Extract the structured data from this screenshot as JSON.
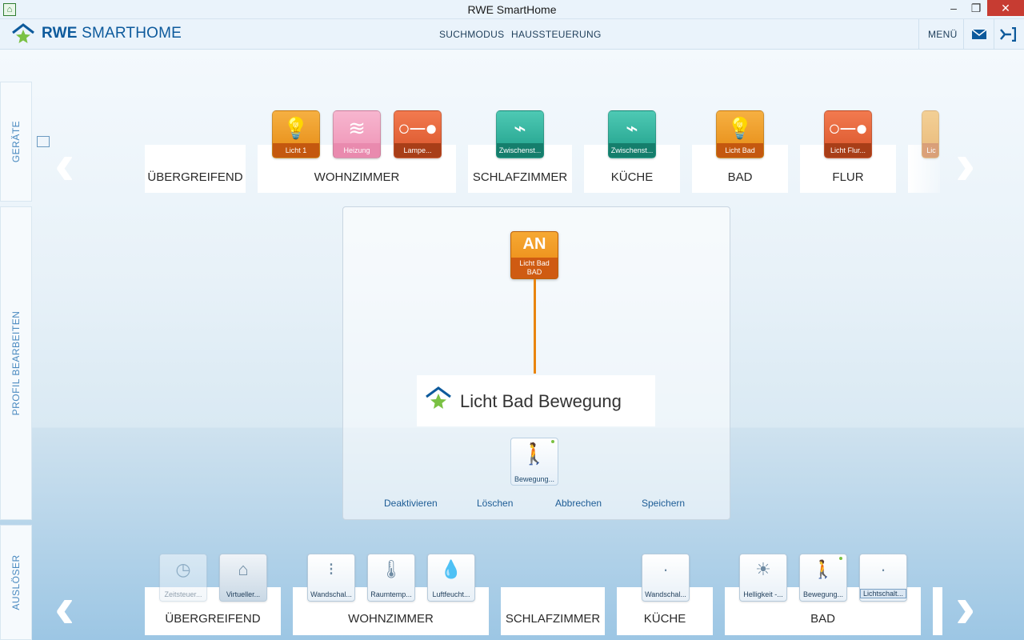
{
  "window": {
    "title": "RWE SmartHome",
    "minimize": "–",
    "restore": "❐",
    "close": "✕"
  },
  "header": {
    "logo_bold": "RWE",
    "logo_rest": " SMARTHOME",
    "nav": {
      "search": "SUCHMODUS",
      "house": "HAUSSTEUERUNG"
    },
    "menu": "MENÜ"
  },
  "sidetabs": {
    "devices": "GERÄTE",
    "profile": "PROFIL BEARBEITEN",
    "triggers": "AUSLÖSER"
  },
  "devices": {
    "rooms": [
      "ÜBERGREIFEND",
      "WOHNZIMMER",
      "SCHLAFZIMMER",
      "KÜCHE",
      "BAD",
      "FLUR"
    ],
    "items": [
      {
        "label": "Licht 1",
        "icon": "lightbulb-icon"
      },
      {
        "label": "Heizung",
        "icon": "heating-icon"
      },
      {
        "label": "Lampe...",
        "icon": "plug-icon"
      },
      {
        "label": "Zwischenst...",
        "icon": "plug-cable-icon"
      },
      {
        "label": "Zwischenst...",
        "icon": "plug-cable-icon"
      },
      {
        "label": "Licht Bad",
        "icon": "lightbulb-icon"
      },
      {
        "label": "Licht Flur...",
        "icon": "plug-icon"
      },
      {
        "label": "Lic",
        "icon": "lightbulb-icon"
      }
    ]
  },
  "profile": {
    "action_big": "AN",
    "action_line1": "Licht Bad",
    "action_line2": "BAD",
    "title": "Licht Bad Bewegung",
    "trigger_label": "Bewegung...",
    "actions": {
      "deactivate": "Deaktivieren",
      "delete": "Löschen",
      "cancel": "Abbrechen",
      "save": "Speichern"
    }
  },
  "triggers": {
    "rooms": [
      "ÜBERGREIFEND",
      "WOHNZIMMER",
      "SCHLAFZIMMER",
      "KÜCHE",
      "BAD"
    ],
    "items": [
      {
        "label": "Zeitsteuer...",
        "icon": "clock-icon"
      },
      {
        "label": "Virtueller...",
        "icon": "virtual-resident-icon"
      },
      {
        "label": "Wandschal...",
        "icon": "wall-switch-icon"
      },
      {
        "label": "Raumtemp...",
        "icon": "thermometer-icon"
      },
      {
        "label": "Luftfeucht...",
        "icon": "humidity-icon"
      },
      {
        "label": "Wandschal...",
        "icon": "wall-switch-icon"
      },
      {
        "label": "Helligkeit -...",
        "icon": "brightness-icon"
      },
      {
        "label": "Bewegung...",
        "icon": "motion-sensor-icon"
      },
      {
        "label": "Lichtschalt...",
        "icon": "light-switch-icon"
      }
    ]
  },
  "colors": {
    "brand_blue": "#0d5a9c",
    "accent_orange": "#e9850f",
    "brand_green": "#7ac143"
  }
}
